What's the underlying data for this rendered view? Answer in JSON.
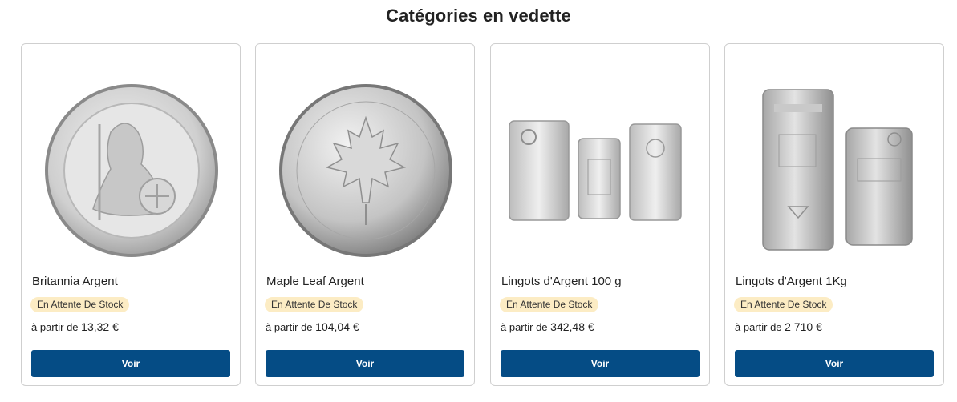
{
  "section": {
    "title": "Catégories en vedette"
  },
  "products": [
    {
      "name": "Britannia Argent",
      "image_alt": "Britannia Argent coin",
      "stock_status": "En Attente De Stock",
      "price_prefix": "à partir de",
      "price": "13,32 €",
      "button_label": "Voir"
    },
    {
      "name": "Maple Leaf Argent",
      "image_alt": "Maple Leaf Argent coin",
      "stock_status": "En Attente De Stock",
      "price_prefix": "à partir de",
      "price": "104,04 €",
      "button_label": "Voir"
    },
    {
      "name": "Lingots d'Argent 100 g",
      "image_alt": "Silver bars 100 g",
      "stock_status": "En Attente De Stock",
      "price_prefix": "à partir de",
      "price": "342,48 €",
      "button_label": "Voir"
    },
    {
      "name": "Lingots d'Argent 1Kg",
      "image_alt": "Silver bars 1 kg",
      "stock_status": "En Attente De Stock",
      "price_prefix": "à partir de",
      "price": "2 710 €",
      "button_label": "Voir"
    }
  ],
  "colors": {
    "button_bg": "#054c85",
    "badge_bg": "#fcecc4",
    "card_border": "#cfcfcf"
  }
}
